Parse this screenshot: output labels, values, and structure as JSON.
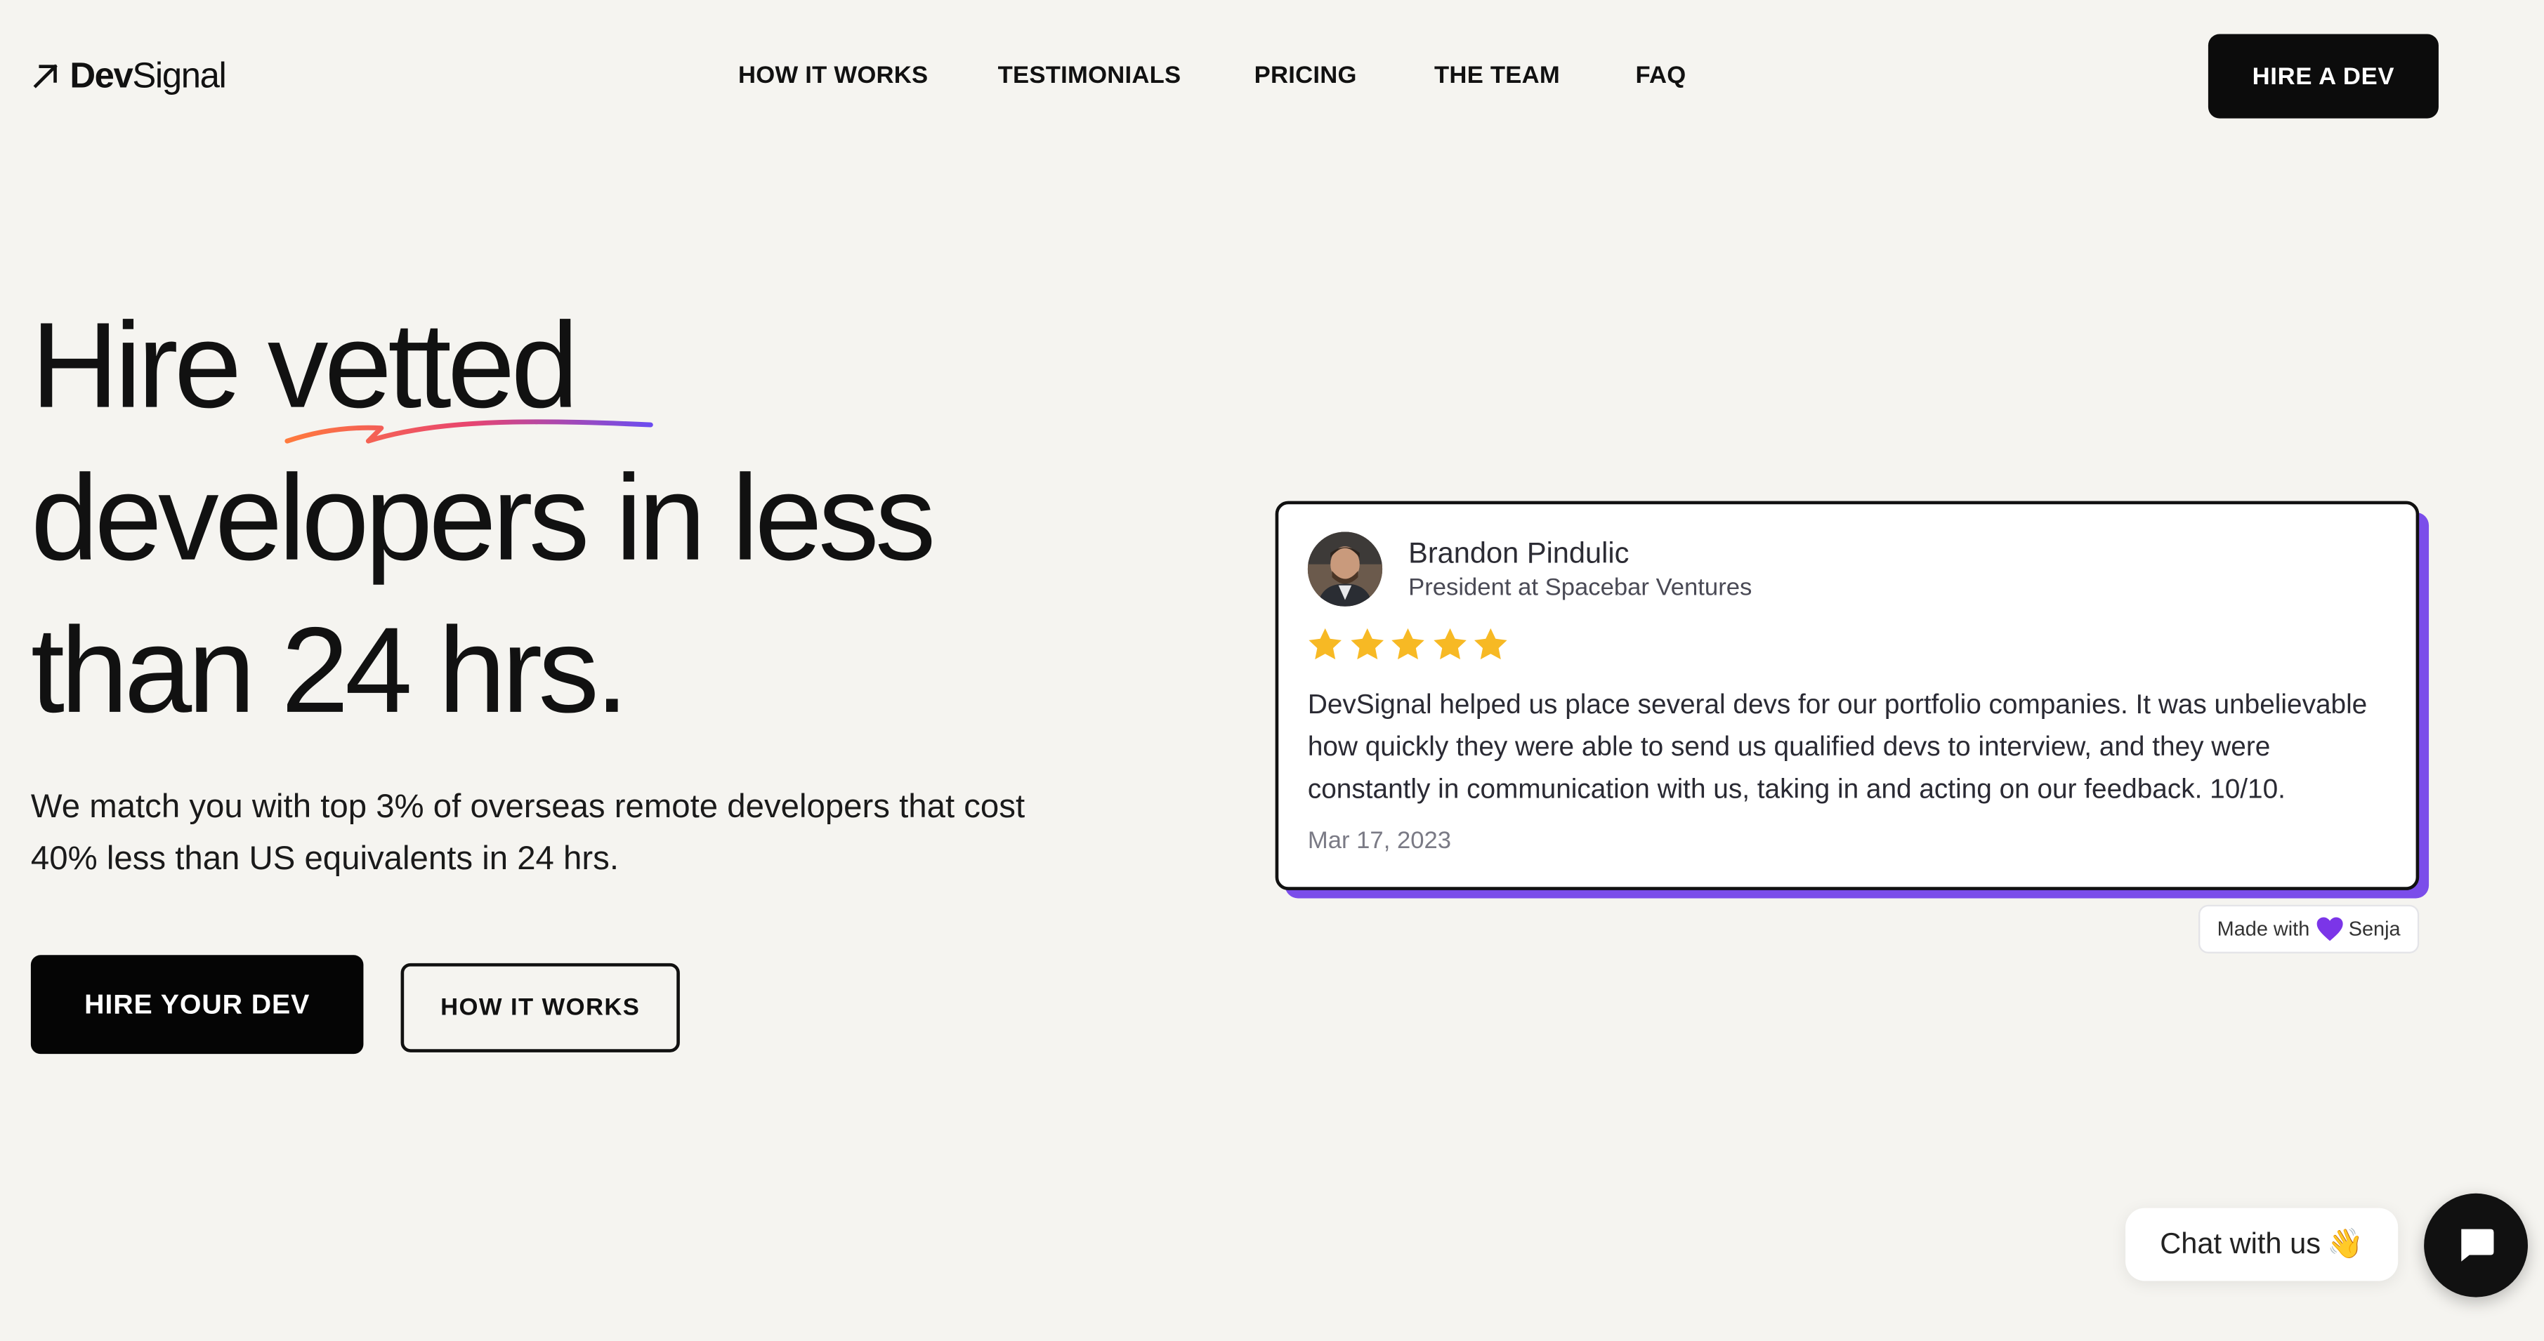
{
  "header": {
    "logo_prefix": "Dev",
    "logo_suffix": "Signal",
    "nav": [
      "HOW IT WORKS",
      "TESTIMONIALS",
      "PRICING",
      "THE TEAM",
      "FAQ"
    ],
    "cta_label": "HIRE A DEV"
  },
  "hero": {
    "title_line1_a": "Hire ",
    "title_line1_b": "vetted",
    "title_line2": "developers in less",
    "title_line3": "than 24 hrs.",
    "subtitle": "We match you with top 3% of overseas remote developers that cost 40% less than US equivalents in 24 hrs.",
    "primary_button": "HIRE YOUR DEV",
    "secondary_button": "HOW IT WORKS"
  },
  "testimonial": {
    "name": "Brandon Pindulic",
    "title": "President at Spacebar Ventures",
    "rating": 5,
    "text": "DevSignal helped us place several devs for our portfolio companies. It was unbelievable how quickly they were able to send us qualified devs to interview, and they were constantly in communication with us, taking in and acting on our feedback. 10/10.",
    "date": "Mar 17, 2023",
    "made_with_prefix": "Made with",
    "made_with_brand": "Senja"
  },
  "chat": {
    "label": "Chat with us",
    "emoji": "👋"
  },
  "colors": {
    "background": "#f5f4f0",
    "button_dark": "#0c0c0c",
    "card_accent": "#7b4dea",
    "star": "#f7b924"
  }
}
